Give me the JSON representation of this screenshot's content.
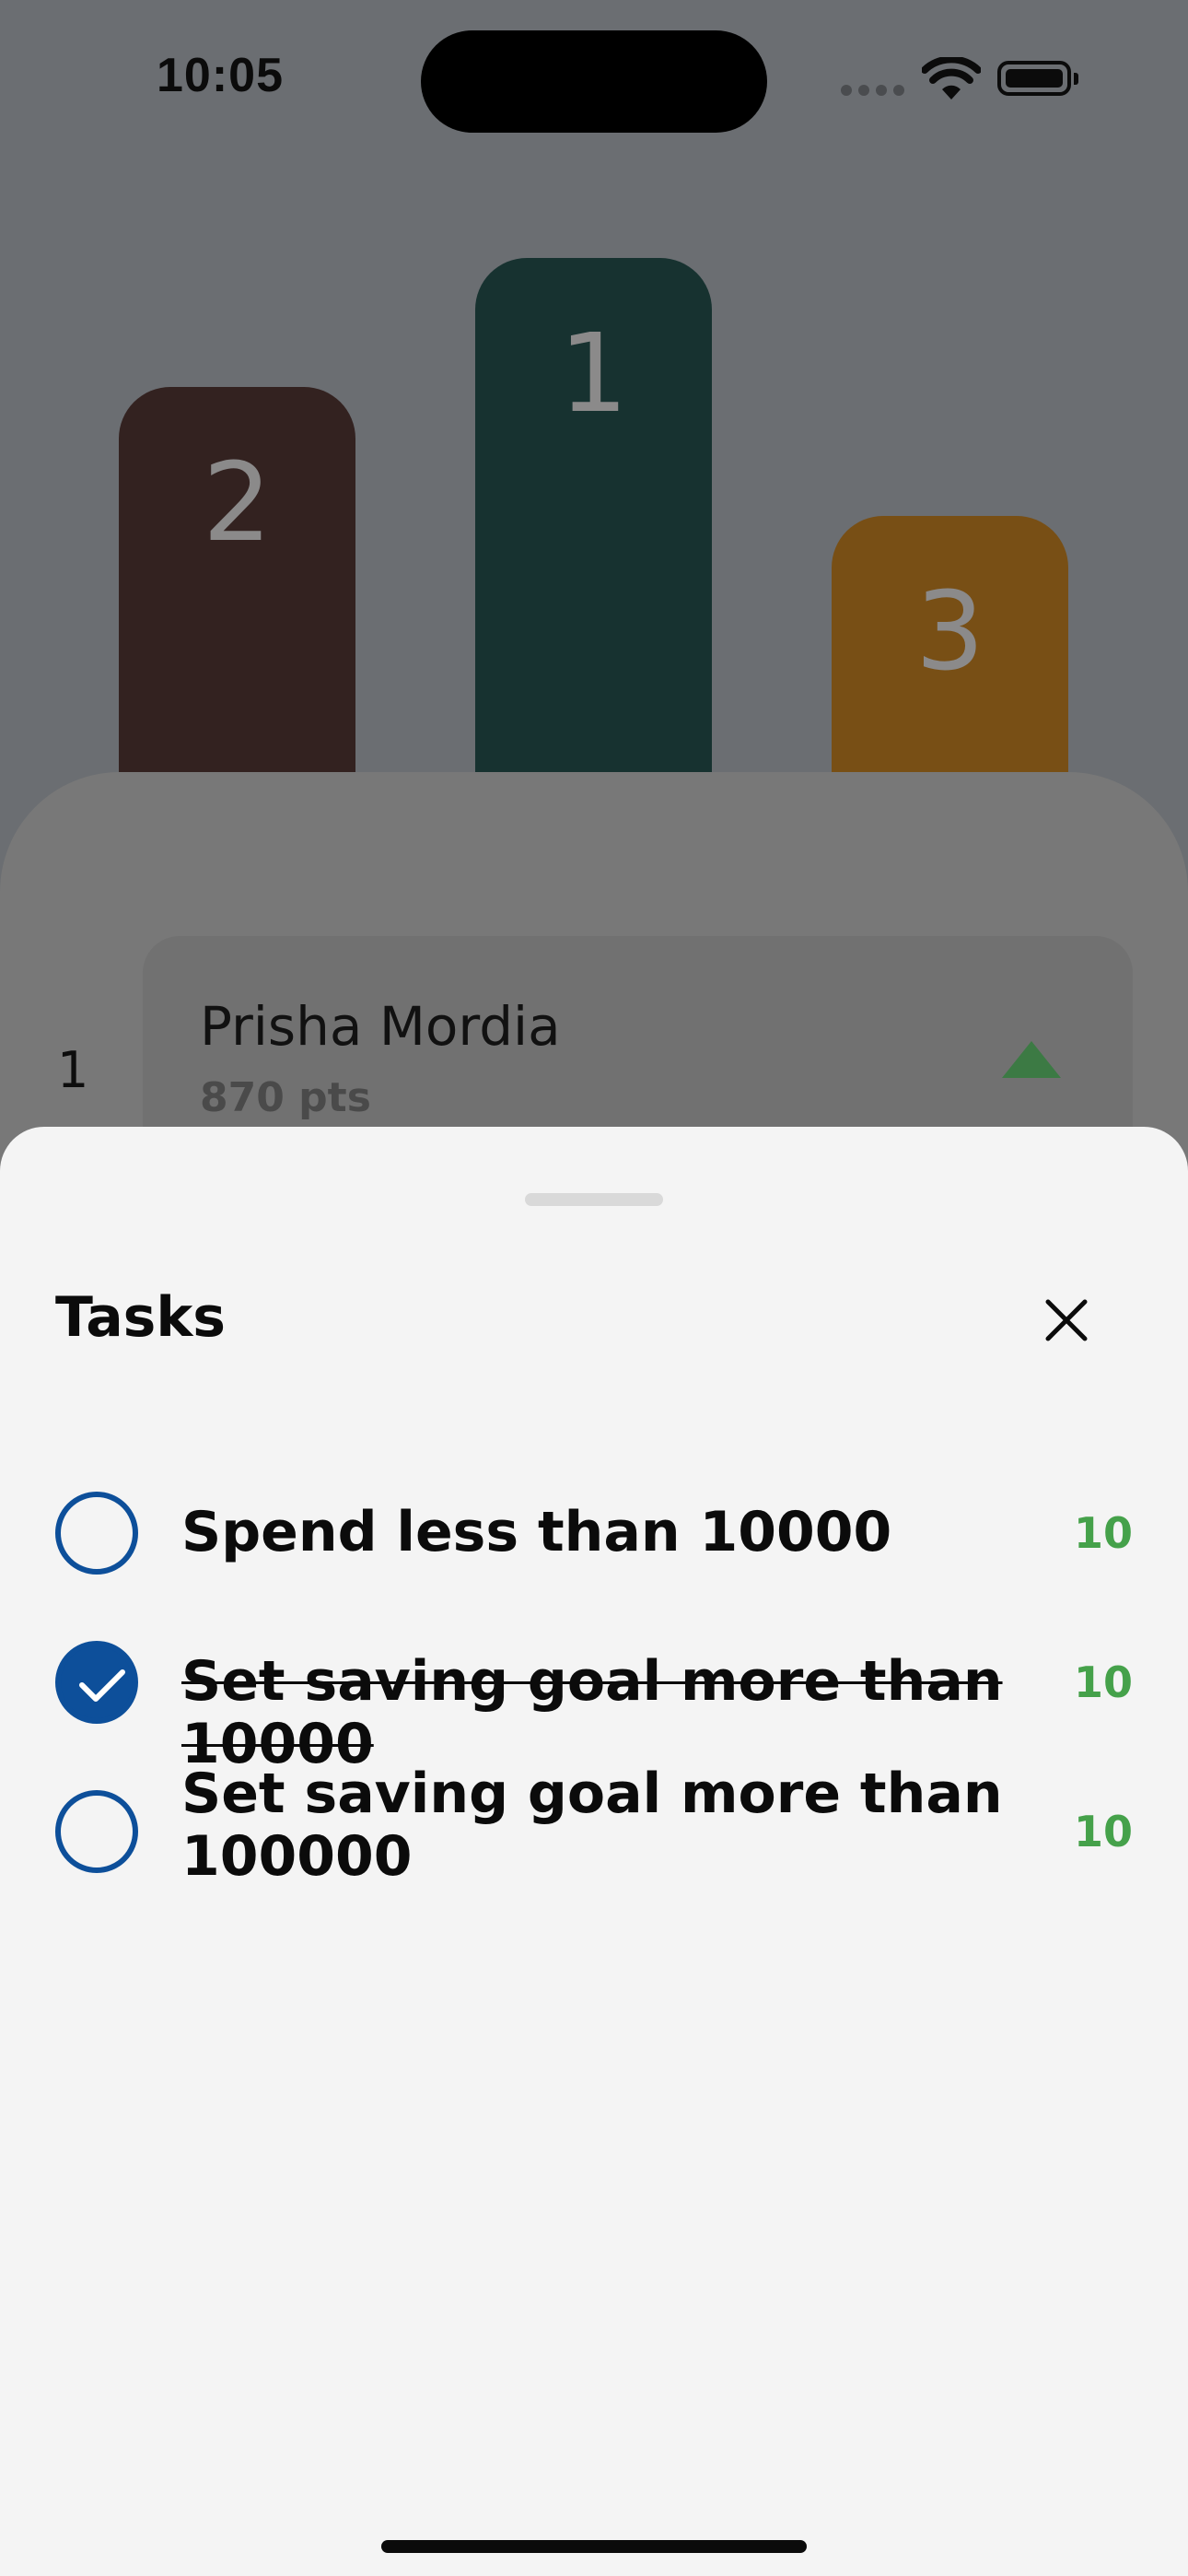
{
  "status_bar": {
    "time": "10:05"
  },
  "podium": [
    {
      "place": "2",
      "color": "#332220"
    },
    {
      "place": "1",
      "color": "#173230"
    },
    {
      "place": "3",
      "color": "#784f15"
    }
  ],
  "leaderboard": {
    "entries": [
      {
        "rank": "1",
        "name": "Prisha Mordia",
        "points": "870 pts",
        "trend": "up"
      }
    ]
  },
  "tasks_sheet": {
    "title": "Tasks",
    "items": [
      {
        "label": "Spend less than 10000",
        "points": "10",
        "completed": false
      },
      {
        "label": "Set saving goal more than 10000",
        "points": "10",
        "completed": true
      },
      {
        "label": "Set saving goal more than 100000",
        "points": "10",
        "completed": false
      }
    ]
  },
  "colors": {
    "accent": "#0d4f9a",
    "points": "#45a14a",
    "trend_up": "#3c7a44"
  }
}
